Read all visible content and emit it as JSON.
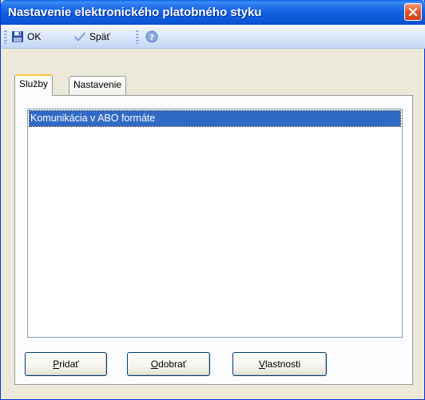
{
  "window": {
    "title": "Nastavenie elektronického platobného styku"
  },
  "toolbar": {
    "ok_label": "OK",
    "back_label": "Späť"
  },
  "tabs": [
    {
      "label": "Služby",
      "active": true
    },
    {
      "label": "Nastavenie",
      "active": false
    }
  ],
  "list": {
    "items": [
      {
        "label": "Komunikácia v ABO formáte",
        "selected": true
      }
    ]
  },
  "buttons": {
    "add": {
      "mnemonic": "P",
      "rest": "ridať"
    },
    "remove": {
      "mnemonic": "O",
      "rest": "dobrať"
    },
    "properties": {
      "mnemonic": "V",
      "rest": "lastnosti"
    }
  },
  "colors": {
    "titlebar": "#0b57d8",
    "selection": "#316ac5",
    "close": "#d2401a",
    "active_tab_accent": "#ffc83c"
  },
  "icons": [
    "save-icon",
    "check-icon",
    "help-icon",
    "close-icon"
  ]
}
